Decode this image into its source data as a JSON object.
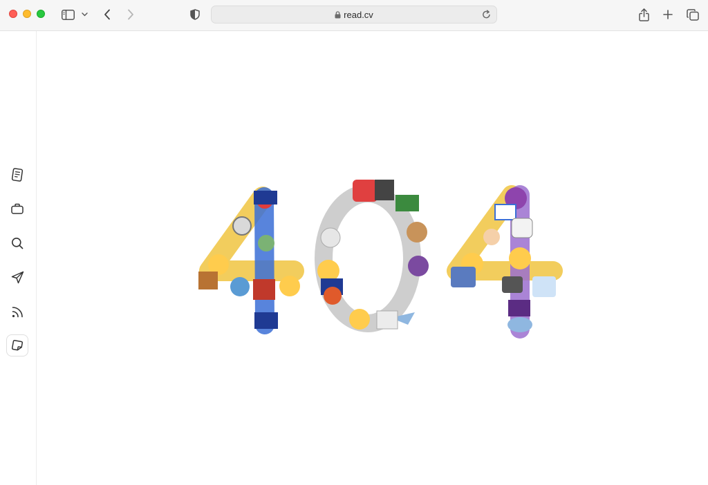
{
  "browser": {
    "url": "read.cv",
    "icons": [
      "sidebar-toggle-icon",
      "chevron-down-icon",
      "back-icon",
      "forward-icon",
      "privacy-shield-icon",
      "lock-icon",
      "reload-icon",
      "share-icon",
      "new-tab-icon",
      "tab-overview-icon"
    ]
  },
  "sidebar": {
    "items": [
      {
        "icon": "document-icon"
      },
      {
        "icon": "briefcase-icon"
      },
      {
        "icon": "search-icon"
      },
      {
        "icon": "send-icon"
      },
      {
        "icon": "rss-icon"
      },
      {
        "icon": "sticky-note-icon",
        "active": true
      }
    ]
  },
  "main": {
    "error_code": "404",
    "art": "emoji-collage"
  },
  "colors": {
    "chrome_bg": "#f6f6f6",
    "traffic_red": "#ff5f57",
    "traffic_yellow": "#febc2e",
    "traffic_green": "#28c840"
  }
}
